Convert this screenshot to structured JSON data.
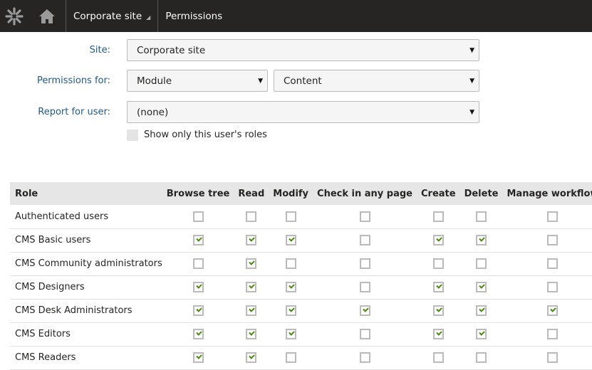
{
  "header": {
    "breadcrumbs": [
      "Corporate site",
      "Permissions"
    ]
  },
  "form": {
    "site_label": "Site:",
    "site_value": "Corporate site",
    "permissions_label": "Permissions for:",
    "permissions_type": "Module",
    "permissions_module": "Content",
    "user_label": "Report for user:",
    "user_value": "(none)",
    "show_only_label": "Show only this user's roles",
    "show_only_checked": false
  },
  "table": {
    "columns": [
      "Role",
      "Browse tree",
      "Read",
      "Modify",
      "Check in any page",
      "Create",
      "Delete",
      "Manage workflow"
    ],
    "rows": [
      {
        "role": "Authenticated users",
        "perms": [
          false,
          false,
          false,
          false,
          false,
          false,
          false
        ]
      },
      {
        "role": "CMS Basic users",
        "perms": [
          true,
          true,
          true,
          false,
          true,
          true,
          false
        ]
      },
      {
        "role": "CMS Community administrators",
        "perms": [
          false,
          true,
          false,
          false,
          false,
          false,
          false
        ]
      },
      {
        "role": "CMS Designers",
        "perms": [
          true,
          true,
          true,
          false,
          true,
          true,
          false
        ]
      },
      {
        "role": "CMS Desk Administrators",
        "perms": [
          true,
          true,
          true,
          true,
          true,
          true,
          true
        ]
      },
      {
        "role": "CMS Editors",
        "perms": [
          true,
          true,
          true,
          false,
          true,
          true,
          false
        ]
      },
      {
        "role": "CMS Readers",
        "perms": [
          true,
          true,
          false,
          false,
          false,
          false,
          false
        ]
      }
    ]
  }
}
